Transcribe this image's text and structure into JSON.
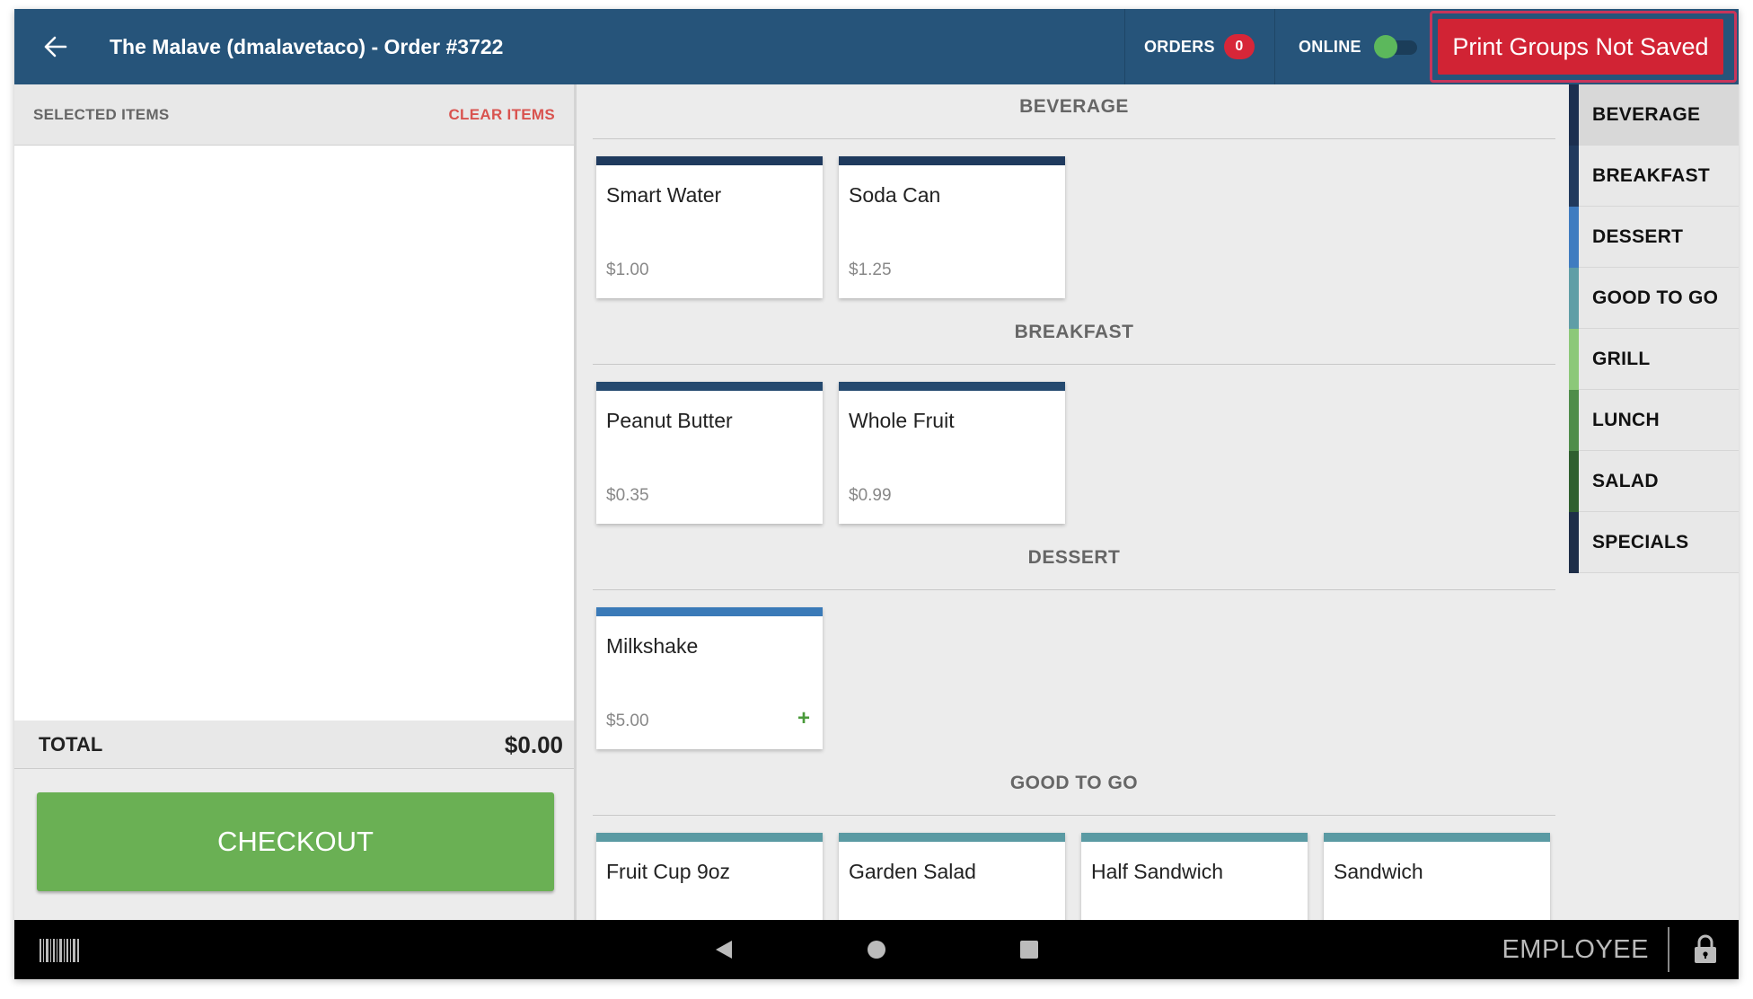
{
  "header": {
    "title": "The Malave (dmalavetaco) - Order #3722",
    "orders_label": "ORDERS",
    "orders_count": "0",
    "online_label": "ONLINE",
    "online_on": true,
    "print_groups_label": "Print Groups Not Saved"
  },
  "left_panel": {
    "selected_items_label": "SELECTED ITEMS",
    "clear_items_label": "CLEAR ITEMS",
    "total_label": "TOTAL",
    "total_value": "$0.00",
    "checkout_label": "CHECKOUT"
  },
  "menu": {
    "sections": [
      {
        "title": "BEVERAGE",
        "color": "#1f3a5e",
        "items": [
          {
            "name": "Smart Water",
            "price": "$1.00"
          },
          {
            "name": "Soda Can",
            "price": "$1.25"
          }
        ]
      },
      {
        "title": "BREAKFAST",
        "color": "#24496f",
        "items": [
          {
            "name": "Peanut Butter",
            "price": "$0.35"
          },
          {
            "name": "Whole Fruit",
            "price": "$0.99"
          }
        ]
      },
      {
        "title": "DESSERT",
        "color": "#3a7ab8",
        "items": [
          {
            "name": "Milkshake",
            "price": "$5.00",
            "has_add": true
          }
        ]
      },
      {
        "title": "GOOD TO GO",
        "color": "#5a9aa3",
        "items": [
          {
            "name": "Fruit Cup 9oz"
          },
          {
            "name": "Garden Salad"
          },
          {
            "name": "Half Sandwich"
          },
          {
            "name": "Sandwich"
          }
        ]
      }
    ],
    "add_icon_glyph": "+"
  },
  "categories": [
    {
      "label": "BEVERAGE",
      "color": "#1c2f4f",
      "active": true
    },
    {
      "label": "BREAKFAST",
      "color": "#213a5e"
    },
    {
      "label": "DESSERT",
      "color": "#3f7cc0"
    },
    {
      "label": "GOOD TO GO",
      "color": "#5f9ea6"
    },
    {
      "label": "GRILL",
      "color": "#8cc879"
    },
    {
      "label": "LUNCH",
      "color": "#4f8d4a"
    },
    {
      "label": "SALAD",
      "color": "#2f5f2f"
    },
    {
      "label": "SPECIALS",
      "color": "#1e2e48"
    }
  ],
  "bottom_bar": {
    "employee_label": "EMPLOYEE",
    "icons": [
      "barcode-icon",
      "back-triangle-icon",
      "home-circle-icon",
      "recents-square-icon",
      "lock-icon"
    ]
  }
}
